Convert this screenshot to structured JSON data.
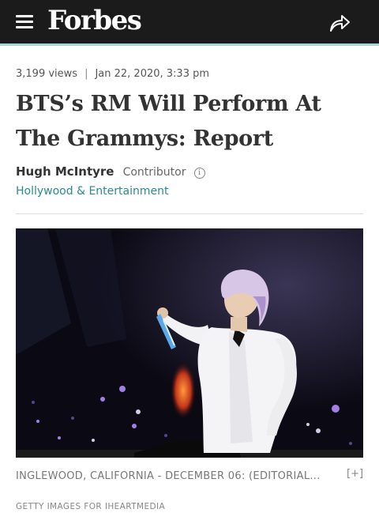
{
  "header": {
    "menu_icon": "hamburger-menu-icon",
    "logo": "Forbes",
    "share_icon": "share-arrow-icon",
    "accent_color": "#a6d7dc",
    "background_color": "#1b1b1b"
  },
  "article": {
    "views": "3,199 views",
    "separator": "|",
    "date": "Jan 22, 2020, 3:33 pm",
    "title": "BTS’s RM Will Perform At The Grammys: Report",
    "author": "Hugh McIntyre",
    "role": "Contributor",
    "info_icon": "info-icon",
    "info_glyph": "i",
    "section": "Hollywood & Entertainment",
    "section_color": "#2a8a8e"
  },
  "photo": {
    "caption": "INGLEWOOD, CALIFORNIA - DECEMBER 06: (EDITORIAL...",
    "expand_label": "[+]",
    "credit": "GETTY IMAGES FOR IHEARTMEDIA"
  }
}
